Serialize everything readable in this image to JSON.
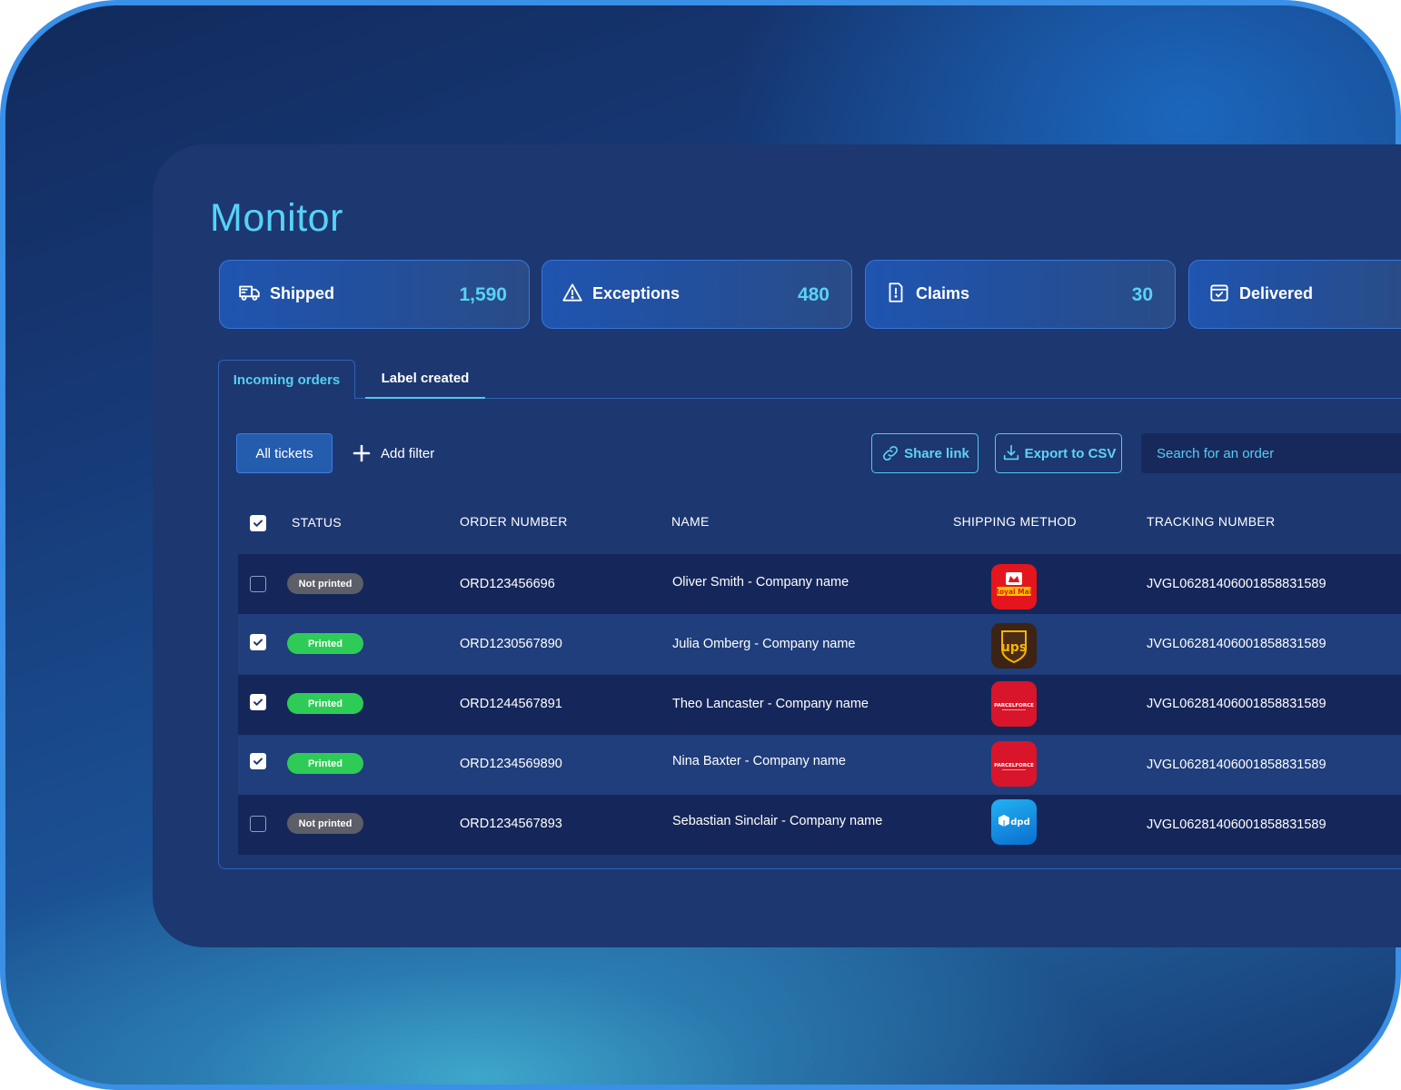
{
  "page": {
    "title": "Monitor"
  },
  "stats": [
    {
      "icon": "truck-icon",
      "label": "Shipped",
      "value": "1,590"
    },
    {
      "icon": "warning-icon",
      "label": "Exceptions",
      "value": "480"
    },
    {
      "icon": "document-alert-icon",
      "label": "Claims",
      "value": "30"
    },
    {
      "icon": "package-check-icon",
      "label": "Delivered",
      "value": ""
    }
  ],
  "tabs": [
    {
      "label": "Incoming orders"
    },
    {
      "label": "Label created",
      "active": true
    }
  ],
  "toolbar": {
    "all_tickets": "All tickets",
    "add_filter": "Add filter",
    "share_link": "Share link",
    "export_csv": "Export to CSV",
    "search_placeholder": "Search for an order"
  },
  "table": {
    "headers": [
      "STATUS",
      "ORDER NUMBER",
      "NAME",
      "SHIPPING METHOD",
      "TRACKING NUMBER"
    ],
    "rows": [
      {
        "checked": false,
        "status": "Not printed",
        "order": "ORD123456696",
        "name": "Oliver Smith - Company name",
        "carrier": "Royal Mail",
        "tracking": "JVGL06281406001858831589"
      },
      {
        "checked": true,
        "status": "Printed",
        "order": "ORD1230567890",
        "name": "Julia Omberg - Company name",
        "carrier": "ups",
        "tracking": "JVGL06281406001858831589"
      },
      {
        "checked": true,
        "status": "Printed",
        "order": "ORD1244567891",
        "name": "Theo Lancaster - Company name",
        "carrier": "PARCELFORCE",
        "tracking": "JVGL06281406001858831589"
      },
      {
        "checked": true,
        "status": "Printed",
        "order": "ORD1234569890",
        "name": "Nina Baxter - Company name",
        "carrier": "PARCELFORCE",
        "tracking": "JVGL06281406001858831589"
      },
      {
        "checked": false,
        "status": "Not printed",
        "order": "ORD1234567893",
        "name": "Sebastian Sinclair - Company name",
        "carrier": "dpd",
        "tracking": "JVGL06281406001858831589"
      }
    ]
  },
  "colors": {
    "accent": "#56d3f7",
    "panel": "#1d3771",
    "printed": "#2ecc57",
    "not_printed": "#5c5e68"
  }
}
